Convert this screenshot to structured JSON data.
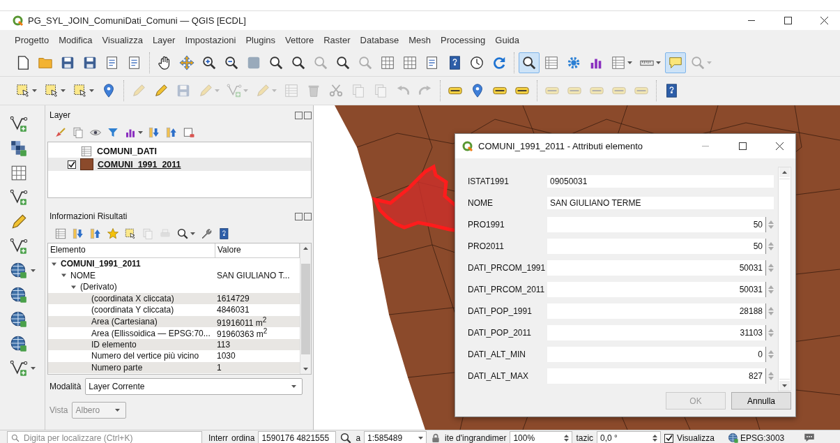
{
  "window": {
    "title": "PG_SYL_JOIN_ComuniDati_Comuni — QGIS [ECDL]"
  },
  "menu": [
    "Progetto",
    "Modifica",
    "Visualizza",
    "Layer",
    "Impostazioni",
    "Plugins",
    "Vettore",
    "Raster",
    "Database",
    "Mesh",
    "Processing",
    "Guida"
  ],
  "toolbars": [
    {
      "groups": [
        [
          {
            "selected": false,
            "dropdown": false,
            "disabled": false
          },
          {
            "selected": false,
            "dropdown": false,
            "disabled": false
          },
          {
            "selected": false,
            "dropdown": false,
            "disabled": false
          },
          {
            "selected": false,
            "dropdown": false,
            "disabled": false
          },
          {
            "selected": false,
            "dropdown": false,
            "disabled": false
          },
          {
            "selected": false,
            "dropdown": false,
            "disabled": false
          }
        ],
        [
          {
            "selected": false,
            "dropdown": false,
            "disabled": false
          },
          {
            "selected": false,
            "dropdown": false,
            "disabled": false
          },
          {
            "selected": false,
            "dropdown": false,
            "disabled": false
          },
          {
            "selected": false,
            "dropdown": false,
            "disabled": false
          },
          {
            "selected": false,
            "dropdown": false,
            "disabled": false
          },
          {
            "selected": false,
            "dropdown": false,
            "disabled": false
          },
          {
            "selected": false,
            "dropdown": false,
            "disabled": false
          },
          {
            "selected": false,
            "dropdown": false,
            "disabled": true
          },
          {
            "selected": false,
            "dropdown": false,
            "disabled": false
          },
          {
            "selected": false,
            "dropdown": false,
            "disabled": true
          },
          {
            "selected": false,
            "dropdown": false,
            "disabled": false
          },
          {
            "selected": false,
            "dropdown": false,
            "disabled": false
          },
          {
            "selected": false,
            "dropdown": false,
            "disabled": false
          },
          {
            "selected": false,
            "dropdown": false,
            "disabled": false
          },
          {
            "selected": false,
            "dropdown": false,
            "disabled": false
          },
          {
            "selected": false,
            "dropdown": false,
            "disabled": false
          }
        ],
        [
          {
            "selected": true,
            "dropdown": false,
            "disabled": false
          },
          {
            "selected": false,
            "dropdown": false,
            "disabled": false
          },
          {
            "selected": false,
            "dropdown": false,
            "disabled": false
          },
          {
            "selected": false,
            "dropdown": false,
            "disabled": false
          },
          {
            "selected": false,
            "dropdown": true,
            "disabled": false
          },
          {
            "selected": false,
            "dropdown": true,
            "disabled": false
          },
          {
            "selected": true,
            "dropdown": false,
            "disabled": false
          },
          {
            "selected": false,
            "dropdown": true,
            "disabled": true
          }
        ]
      ]
    },
    {
      "groups": [
        [
          {
            "selected": false,
            "dropdown": true,
            "disabled": false
          },
          {
            "selected": false,
            "dropdown": true,
            "disabled": false
          },
          {
            "selected": false,
            "dropdown": true,
            "disabled": false
          },
          {
            "selected": false,
            "dropdown": false,
            "disabled": false
          }
        ],
        [
          {
            "selected": false,
            "dropdown": false,
            "disabled": true
          },
          {
            "selected": false,
            "dropdown": false,
            "disabled": false
          },
          {
            "selected": false,
            "dropdown": false,
            "disabled": true
          },
          {
            "selected": false,
            "dropdown": true,
            "disabled": true
          },
          {
            "selected": false,
            "dropdown": true,
            "disabled": true
          },
          {
            "selected": false,
            "dropdown": true,
            "disabled": true
          },
          {
            "selected": false,
            "dropdown": false,
            "disabled": true
          },
          {
            "selected": false,
            "dropdown": false,
            "disabled": true
          },
          {
            "selected": false,
            "dropdown": false,
            "disabled": true
          },
          {
            "selected": false,
            "dropdown": false,
            "disabled": true
          },
          {
            "selected": false,
            "dropdown": false,
            "disabled": true
          },
          {
            "selected": false,
            "dropdown": false,
            "disabled": true
          },
          {
            "selected": false,
            "dropdown": false,
            "disabled": true
          }
        ],
        [
          {
            "selected": false,
            "dropdown": false,
            "disabled": false
          },
          {
            "selected": false,
            "dropdown": false,
            "disabled": false
          },
          {
            "selected": false,
            "dropdown": false,
            "disabled": false
          },
          {
            "selected": false,
            "dropdown": false,
            "disabled": false
          }
        ],
        [
          {
            "selected": false,
            "dropdown": false,
            "disabled": true
          },
          {
            "selected": false,
            "dropdown": false,
            "disabled": true
          },
          {
            "selected": false,
            "dropdown": false,
            "disabled": true
          },
          {
            "selected": false,
            "dropdown": false,
            "disabled": true
          },
          {
            "selected": false,
            "dropdown": false,
            "disabled": true
          }
        ],
        [
          {
            "selected": false,
            "dropdown": false,
            "disabled": false
          }
        ]
      ]
    }
  ],
  "side_toolbar": [
    {
      "dropdown": false
    },
    {
      "dropdown": false
    },
    {
      "dropdown": false
    },
    {
      "dropdown": false
    },
    {
      "dropdown": false
    },
    {
      "dropdown": false
    },
    {
      "dropdown": true
    },
    {
      "dropdown": false
    },
    {
      "dropdown": false
    },
    {
      "dropdown": false
    },
    {
      "dropdown": true
    }
  ],
  "layer_panel": {
    "title": "Layer",
    "tools": [
      {
        "dropdown": false
      },
      {
        "dropdown": false
      },
      {
        "dropdown": false
      },
      {
        "dropdown": false
      },
      {
        "dropdown": true
      },
      {
        "dropdown": false
      },
      {
        "dropdown": false
      },
      {
        "dropdown": false
      }
    ],
    "layers": [
      {
        "name": "COMUNI_DATI",
        "kind": "table",
        "selected": false
      },
      {
        "name": "COMUNI_1991_2011",
        "kind": "polygon",
        "checked": true,
        "color": "#8b4a2b",
        "selected": true
      }
    ]
  },
  "results_panel": {
    "title": "Informazioni Risultati",
    "tools": [
      {
        "dropdown": false,
        "disabled": false
      },
      {
        "dropdown": false,
        "disabled": false
      },
      {
        "dropdown": false,
        "disabled": false
      },
      {
        "dropdown": false,
        "disabled": false
      },
      {
        "dropdown": false,
        "disabled": false
      },
      {
        "dropdown": false,
        "disabled": true
      },
      {
        "dropdown": false,
        "disabled": true
      },
      {
        "dropdown": true,
        "disabled": false
      },
      {
        "dropdown": false,
        "disabled": false
      },
      {
        "dropdown": false,
        "disabled": false
      }
    ],
    "columns": [
      "Elemento",
      "Valore"
    ],
    "rows": [
      {
        "label": "COMUNI_1991_2011",
        "expanded": true,
        "children": [
          {
            "label": "NOME",
            "value": "SAN GIULIANO T...",
            "expanded": true,
            "children": [
              {
                "label": "(Derivato)",
                "expanded": true,
                "children": [
                  {
                    "label": "(coordinata X cliccata)",
                    "value": "1614729"
                  },
                  {
                    "label": "(coordinata Y cliccata)",
                    "value": "4846031"
                  },
                  {
                    "label": "Area (Cartesiana)",
                    "value": "91916011  m$^{2}$"
                  },
                  {
                    "label": "Area (Ellissoidica — EPSG:70...",
                    "value": "91960363  m$^{2}$"
                  },
                  {
                    "label": "ID elemento",
                    "value": "113"
                  },
                  {
                    "label": "Numero del vertice più vicino",
                    "value": "1030"
                  },
                  {
                    "label": "Numero parte",
                    "value": "1"
                  }
                ]
              }
            ]
          }
        ]
      }
    ],
    "mode_label": "Modalità",
    "mode_value": "Layer Corrente",
    "view_label": "Vista",
    "view_value": "Albero",
    "view_disabled": true
  },
  "dialog": {
    "title": "COMUNI_1991_2011 - Attributi elemento",
    "fields": [
      {
        "label": "ISTAT1991",
        "value": "09050031",
        "kind": "text"
      },
      {
        "label": "NOME",
        "value": "SAN GIULIANO TERME",
        "kind": "text"
      },
      {
        "label": "PRO1991",
        "value": "50",
        "kind": "number"
      },
      {
        "label": "PRO2011",
        "value": "50",
        "kind": "number"
      },
      {
        "label": "DATI_PRCOM_1991",
        "value": "50031",
        "kind": "number"
      },
      {
        "label": "DATI_PRCOM_2011",
        "value": "50031",
        "kind": "number"
      },
      {
        "label": "DATI_POP_1991",
        "value": "28188",
        "kind": "number"
      },
      {
        "label": "DATI_POP_2011",
        "value": "31103",
        "kind": "number"
      },
      {
        "label": "DATI_ALT_MIN",
        "value": "0",
        "kind": "number"
      },
      {
        "label": "DATI_ALT_MAX",
        "value": "827",
        "kind": "number"
      }
    ],
    "buttons": [
      {
        "label": "OK",
        "disabled": true
      },
      {
        "label": "Annulla",
        "disabled": false
      }
    ]
  },
  "status_bar": {
    "locator_placeholder": "Digita per localizzare (Ctrl+K)",
    "coord_label_1": "Interr",
    "coord_label_2": "ordina",
    "coordinate": "1590176 4821555",
    "scale_label": "a",
    "scale": "1:585489",
    "magnifier_label": "ite d'ingrandimer",
    "magnifier": "100%",
    "rotation_label": "tazic",
    "rotation": "0,0 °",
    "render_checked": true,
    "render_label": "Visualizza",
    "crs": "EPSG:3003"
  }
}
